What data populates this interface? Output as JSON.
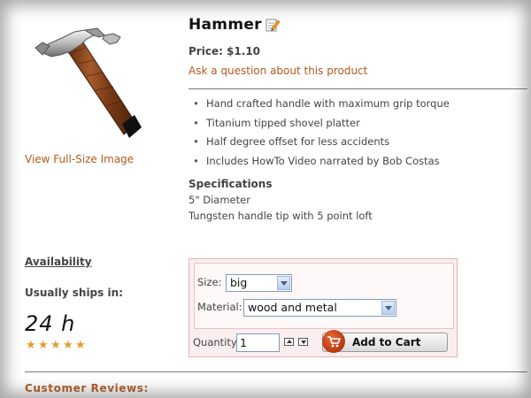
{
  "product": {
    "title": "Hammer",
    "price": "Price: $1.10",
    "ask_link": "Ask a question about this product",
    "view_full_size": "View Full-Size Image",
    "features": [
      "Hand crafted handle with maximum grip torque",
      "Titanium tipped shovel platter",
      "Half degree offset for less accidents",
      "Includes HowTo Video narrated by Bob Costas"
    ],
    "specifications": {
      "title": "Specifications",
      "lines": [
        "5\" Diameter",
        "Tungsten handle tip with 5 point loft"
      ]
    }
  },
  "availability": {
    "label": "Availability",
    "ships_label": "Usually ships in:",
    "ship_time": "24 h",
    "rating_stars": 5
  },
  "options": {
    "size_label": "Size:",
    "size_value": "big",
    "material_label": "Material:",
    "material_value": "wood and metal",
    "quantity_label": "Quantity:",
    "quantity_value": "1",
    "add_to_cart": "Add to Cart"
  },
  "reviews": {
    "heading": "Customer Reviews:"
  },
  "colors": {
    "link": "#b35a1f",
    "star": "#e29b2a",
    "options_bg": "#fbeeee",
    "cart_icon": "#c0441a"
  },
  "icons": [
    "edit-icon",
    "cart-icon",
    "star-icon",
    "stepper-up-icon",
    "stepper-down-icon"
  ]
}
